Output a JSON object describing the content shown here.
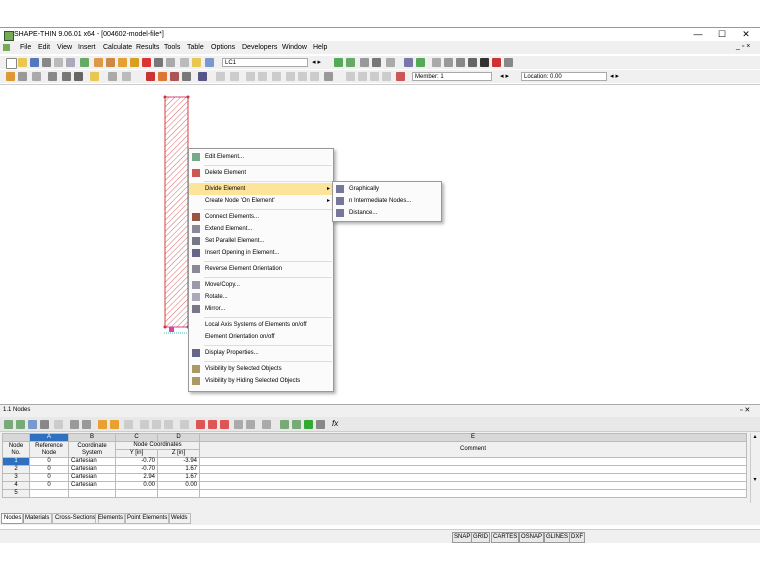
{
  "window": {
    "title": "SHAPE-THIN 9.06.01 x64 - [004602-model-file*]",
    "min": "—",
    "max": "☐",
    "close": "✕"
  },
  "menu": [
    "File",
    "Edit",
    "View",
    "Insert",
    "Calculate",
    "Results",
    "Tools",
    "Table",
    "Options",
    "Developers",
    "Window",
    "Help"
  ],
  "toolbar": {
    "load_case": "LC1",
    "member": "Member: 1",
    "location": "Location: 0.00"
  },
  "context_menu": {
    "items": [
      {
        "label": "Edit Element...",
        "icon": "edit-element-icon"
      },
      {
        "label": "Delete Element",
        "icon": "delete-element-icon"
      },
      {
        "label": "Divide Element",
        "icon": "",
        "submenu": true,
        "highlighted": true
      },
      {
        "label": "Create Node 'On Element'",
        "icon": "",
        "submenu": true
      },
      {
        "label": "Connect Elements...",
        "icon": "connect-elements-icon"
      },
      {
        "label": "Extend Element...",
        "icon": "extend-element-icon"
      },
      {
        "label": "Set Parallel Element...",
        "icon": "parallel-element-icon"
      },
      {
        "label": "Insert Opening in Element...",
        "icon": "insert-opening-icon"
      },
      {
        "label": "Reverse Element Orientation",
        "icon": "reverse-orientation-icon"
      },
      {
        "label": "Move/Copy...",
        "icon": "move-copy-icon"
      },
      {
        "label": "Rotate...",
        "icon": "rotate-icon"
      },
      {
        "label": "Mirror...",
        "icon": "mirror-icon"
      },
      {
        "label": "Local Axis Systems of Elements on/off",
        "icon": ""
      },
      {
        "label": "Element Orientation on/off",
        "icon": ""
      },
      {
        "label": "Display Properties...",
        "icon": "display-properties-icon"
      },
      {
        "label": "Visibility by Selected Objects",
        "icon": "visibility-selected-icon"
      },
      {
        "label": "Visibility by Hiding Selected Objects",
        "icon": "visibility-hiding-icon"
      }
    ]
  },
  "submenu": {
    "items": [
      "Graphically",
      "n Intermediate Nodes...",
      "Distance..."
    ]
  },
  "panel": {
    "title": "1.1 Nodes",
    "col_letters": [
      "A",
      "B",
      "C",
      "D",
      "E"
    ],
    "headers": {
      "node": "Node No.",
      "ref": "Reference Node",
      "coord": "Coordinate System",
      "nodecoords": "Node Coordinates",
      "y": "Y [in]",
      "z": "Z [in]",
      "comment": "Comment"
    },
    "rows": [
      {
        "no": "1",
        "ref": "0",
        "sys": "Cartesian",
        "y": "-0.70",
        "z": "-3.94"
      },
      {
        "no": "2",
        "ref": "0",
        "sys": "Cartesian",
        "y": "-0.70",
        "z": "1.67"
      },
      {
        "no": "3",
        "ref": "0",
        "sys": "Cartesian",
        "y": "2.94",
        "z": "1.67"
      },
      {
        "no": "4",
        "ref": "0",
        "sys": "Cartesian",
        "y": "0.00",
        "z": "0.00"
      },
      {
        "no": "5",
        "ref": "",
        "sys": "",
        "y": "",
        "z": ""
      }
    ],
    "tabs": [
      "Nodes",
      "Materials",
      "Cross-Sections",
      "Elements",
      "Point Elements",
      "Welds"
    ]
  },
  "status": [
    "SNAP",
    "GRID",
    "CARTES",
    "OSNAP",
    "GLINES",
    "DXF"
  ]
}
